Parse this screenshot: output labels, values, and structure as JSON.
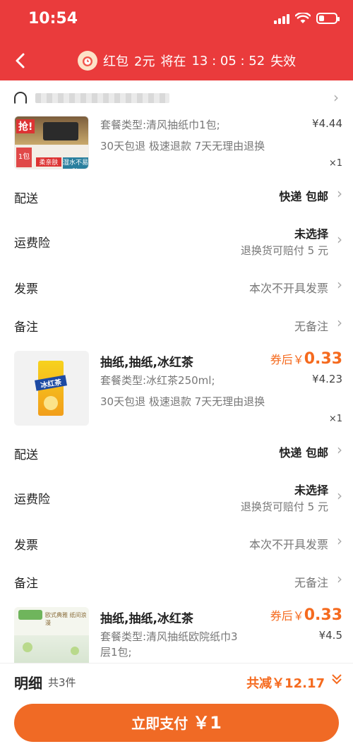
{
  "status": {
    "time": "10:54"
  },
  "nav": {
    "banner_prefix": "红包",
    "amount": "2元",
    "middle": "将在",
    "countdown": "13 : 05 : 52",
    "suffix": "失效"
  },
  "products": [
    {
      "name": "",
      "spec": "套餐类型:清风抽纸巾1包;",
      "services": "30天包退  极速退款  7天无理由退换",
      "price": "¥4.44",
      "qty": "×1",
      "coupon_label": "",
      "coupon_value": "",
      "thumb_text": {
        "top": "抢!",
        "badge": "1包",
        "label1": "柔亲肤",
        "label2": "湿水不易破"
      },
      "rows": {
        "delivery_label": "配送",
        "delivery_value": "快递 包邮",
        "insurance_label": "运费险",
        "insurance_value": "未选择",
        "insurance_sub": "退换货可赔付 5 元",
        "invoice_label": "发票",
        "invoice_value": "本次不开具发票",
        "note_label": "备注",
        "note_value": "无备注"
      }
    },
    {
      "name": "抽纸,抽纸,冰红茶",
      "spec": "套餐类型:冰红茶250ml;",
      "services": "30天包退  极速退款  7天无理由退换",
      "price": "¥4.23",
      "qty": "×1",
      "coupon_label": "券后￥",
      "coupon_value": "0.33",
      "thumb_text": {
        "top": "冰红茶"
      },
      "rows": {
        "delivery_label": "配送",
        "delivery_value": "快递 包邮",
        "insurance_label": "运费险",
        "insurance_value": "未选择",
        "insurance_sub": "退换货可赔付 5 元",
        "invoice_label": "发票",
        "invoice_value": "本次不开具发票",
        "note_label": "备注",
        "note_value": "无备注"
      }
    },
    {
      "name": "抽纸,抽纸,冰红茶",
      "spec": "套餐类型:清风抽纸欧院纸巾3层1包;",
      "services": "",
      "price": "¥4.5",
      "qty": "",
      "coupon_label": "券后￥",
      "coupon_value": "0.33",
      "thumb_text": {
        "top": "欧式典雅 纸间浪漫"
      }
    }
  ],
  "summary": {
    "title": "明细",
    "count": "共3件",
    "reduce": "共减￥12.17"
  },
  "pay": {
    "label": "立即支付",
    "amount": "￥1"
  },
  "colors": {
    "header": "#ea3b3c",
    "accent": "#f56a1e",
    "pay_button": "#f06a25"
  }
}
